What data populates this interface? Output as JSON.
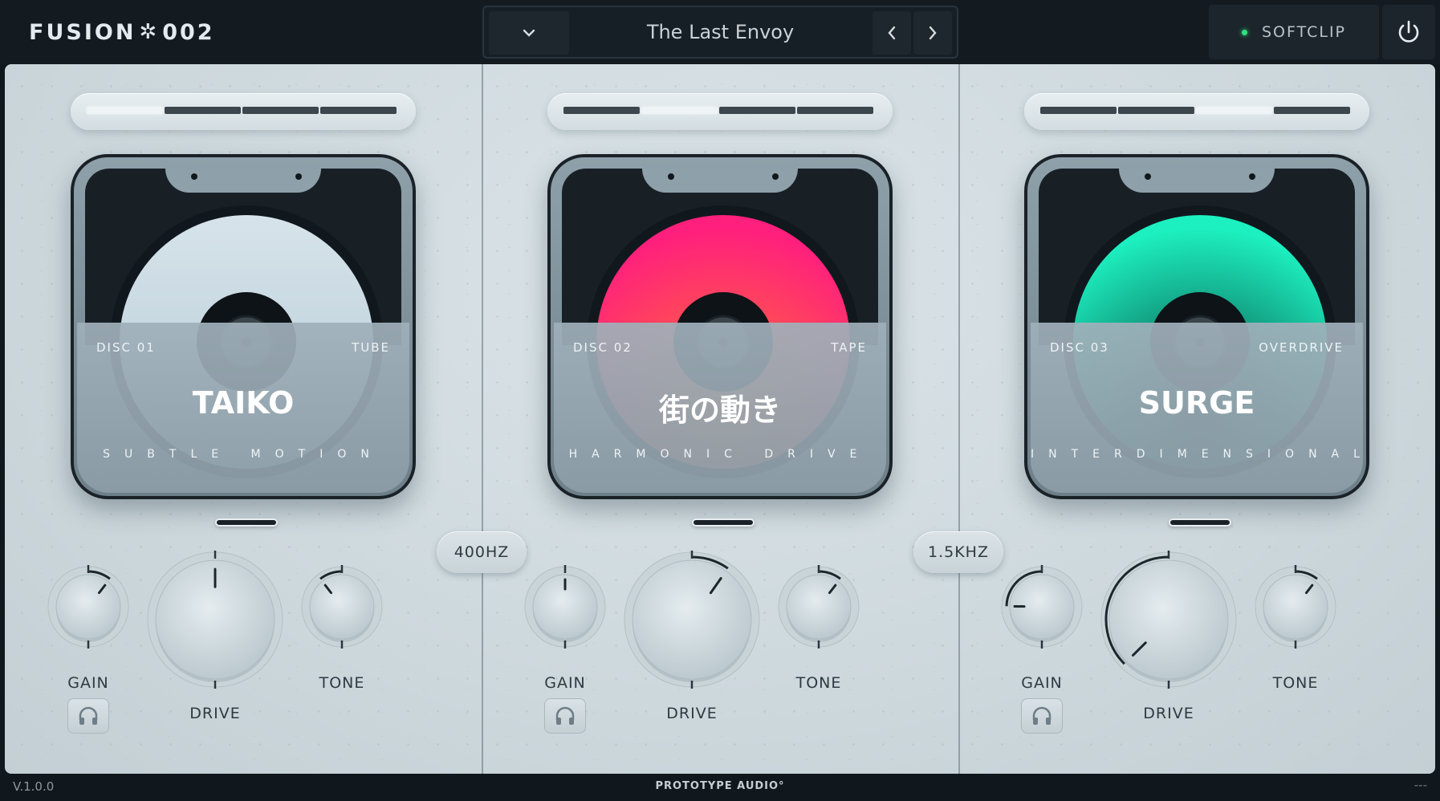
{
  "app": {
    "logo_left": "FUSION",
    "logo_right": "002",
    "logo_icon": "star-burst-icon"
  },
  "preset": {
    "name": "The Last Envoy",
    "dropdown_icon": "chevron-down-icon",
    "prev_icon": "chevron-left-icon",
    "next_icon": "chevron-right-icon"
  },
  "softclip": {
    "label": "SOFTCLIP",
    "active": true,
    "led_color": "#2fe07c"
  },
  "power_icon": "power-icon",
  "crossovers": [
    "400HZ",
    "1.5KHZ"
  ],
  "channels": [
    {
      "disc_no": "DISC 01",
      "type": "TUBE",
      "title": "TAIKO",
      "subtitle": "SUBTLE MOTION",
      "selected_slot": 1,
      "slots": 4,
      "disc_color": "#c9d9e2",
      "gain_label": "GAIN",
      "drive_label": "DRIVE",
      "tone_label": "TONE",
      "gain": 0.64,
      "drive": 0.5,
      "tone": 0.36
    },
    {
      "disc_no": "DISC 02",
      "type": "TAPE",
      "title": "街の動き",
      "subtitle": "HARMONIC DRIVE",
      "selected_slot": 2,
      "slots": 4,
      "disc_color": "#ff2f7a",
      "gain_label": "GAIN",
      "drive_label": "DRIVE",
      "tone_label": "TONE",
      "gain": 0.5,
      "drive": 0.63,
      "tone": 0.64
    },
    {
      "disc_no": "DISC 03",
      "type": "OVERDRIVE",
      "title": "SURGE",
      "subtitle": "INTERDIMENSIONAL",
      "selected_slot": 3,
      "slots": 4,
      "disc_color": "#1de8b8",
      "gain_label": "GAIN",
      "drive_label": "DRIVE",
      "tone_label": "TONE",
      "gain": 0.17,
      "drive": 0.0,
      "tone": 0.64
    }
  ],
  "footer": {
    "version": "V.1.0.0",
    "brand": "PROTOTYPE AUDIO°",
    "status": "---"
  },
  "colors": {
    "panel": "#d3dde1",
    "frame": "#1a2228",
    "topbar": "#131b21"
  }
}
